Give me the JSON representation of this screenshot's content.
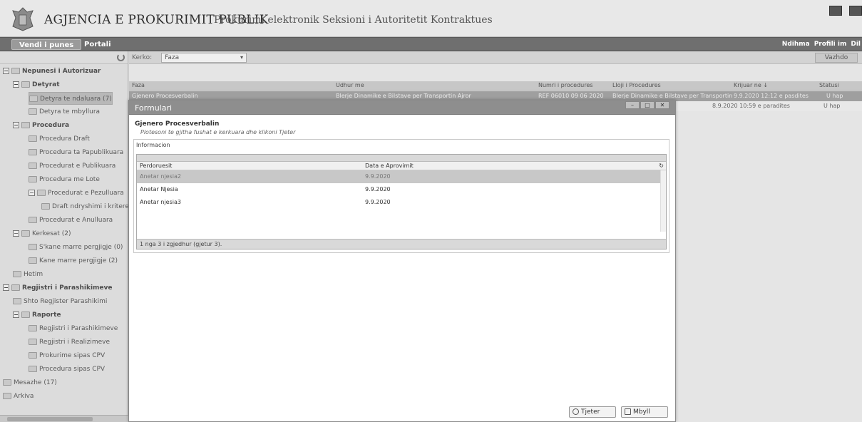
{
  "header": {
    "agency": "AGJENCIA E PROKURIMIT PUBLIK",
    "subtitle": "Prokurimi elektronik  Seksioni i Autoritetit Kontraktues"
  },
  "nav": {
    "tab_active": "Vendi i punes",
    "tab_portal": "Portali",
    "right_links": [
      "Ndihma",
      "Profili im",
      "Dil"
    ]
  },
  "sidebar": {
    "items": [
      {
        "label": "Nepunesi i Autorizuar",
        "level": 0,
        "bold": true,
        "expander": "−"
      },
      {
        "label": "Detyrat",
        "level": 1,
        "bold": true,
        "expander": "−"
      },
      {
        "label": "Detyra te ndaluara (7)",
        "level": 2,
        "selected": true
      },
      {
        "label": "Detyra te mbyllura",
        "level": 2
      },
      {
        "label": "Procedura",
        "level": 1,
        "bold": true,
        "expander": "−"
      },
      {
        "label": "Procedura Draft",
        "level": 2
      },
      {
        "label": "Procedura ta Papublikuara",
        "level": 2
      },
      {
        "label": "Procedurat e Publikuara",
        "level": 2
      },
      {
        "label": "Procedura me Lote",
        "level": 2
      },
      {
        "label": "Procedurat e Pezulluara",
        "level": 2,
        "expander": "−"
      },
      {
        "label": "Draft ndryshimi i kritereve",
        "level": 3
      },
      {
        "label": "Procedurat e Anulluara",
        "level": 2
      },
      {
        "label": "Kerkesat (2)",
        "level": 1,
        "expander": "−"
      },
      {
        "label": "S'kane marre pergjigje (0)",
        "level": 2
      },
      {
        "label": "Kane marre pergjigje (2)",
        "level": 2
      },
      {
        "label": "Hetim",
        "level": 1
      },
      {
        "label": "Regjistri i Parashikimeve",
        "level": 0,
        "bold": true,
        "expander": "−"
      },
      {
        "label": "Shto Regjister Parashikimi",
        "level": 1
      },
      {
        "label": "Raporte",
        "level": 1,
        "bold": true,
        "expander": "−"
      },
      {
        "label": "Regjistri i Parashikimeve",
        "level": 2
      },
      {
        "label": "Regjistri i Realizimeve",
        "level": 2
      },
      {
        "label": "Prokurime sipas CPV",
        "level": 2
      },
      {
        "label": "Procedura sipas CPV",
        "level": 2
      },
      {
        "label": "Mesazhe (17)",
        "level": 0
      },
      {
        "label": "Arkiva",
        "level": 0
      }
    ]
  },
  "search": {
    "label": "Kerko:",
    "selected": "Faza",
    "button": "Vazhdo"
  },
  "grid": {
    "columns": [
      "Faza",
      "Udhur me",
      "Numri i procedures",
      "Lloji i Procedures",
      "Krijuar ne ↓",
      "Statusi"
    ],
    "rows": [
      [
        "Gjenero Procesverbalin",
        "Blerje Dinamike e Bilstave per Transportin Ajror",
        "REF 06010 09 06 2020",
        "Blerje Dinamike e Bilstave per Transportin Ajror",
        "9.9.2020 12:12 e pasdites",
        "U hap"
      ],
      [
        "",
        "",
        "",
        "",
        "8.9.2020 10:59 e paradites",
        "U hap"
      ]
    ]
  },
  "modal": {
    "title": "Formulari",
    "heading": "Gjenero Procesverbalin",
    "hint": "Plotesoni te gjitha fushat e kerkuara dhe klikoni Tjeter",
    "info_label": "Informacion",
    "inner_columns": [
      "Perdoruesit",
      "Data e Aprovimit"
    ],
    "inner_rows": [
      {
        "user": "Anetar njesia2",
        "date": "9.9.2020"
      },
      {
        "user": "Anetar Njesia",
        "date": "9.9.2020"
      },
      {
        "user": "Anetar njesia3",
        "date": "9.9.2020"
      }
    ],
    "footer": "1 nga 3 i zgjedhur (gjetur 3).",
    "btn_next": "Tjeter",
    "btn_close": "Mbyll"
  }
}
